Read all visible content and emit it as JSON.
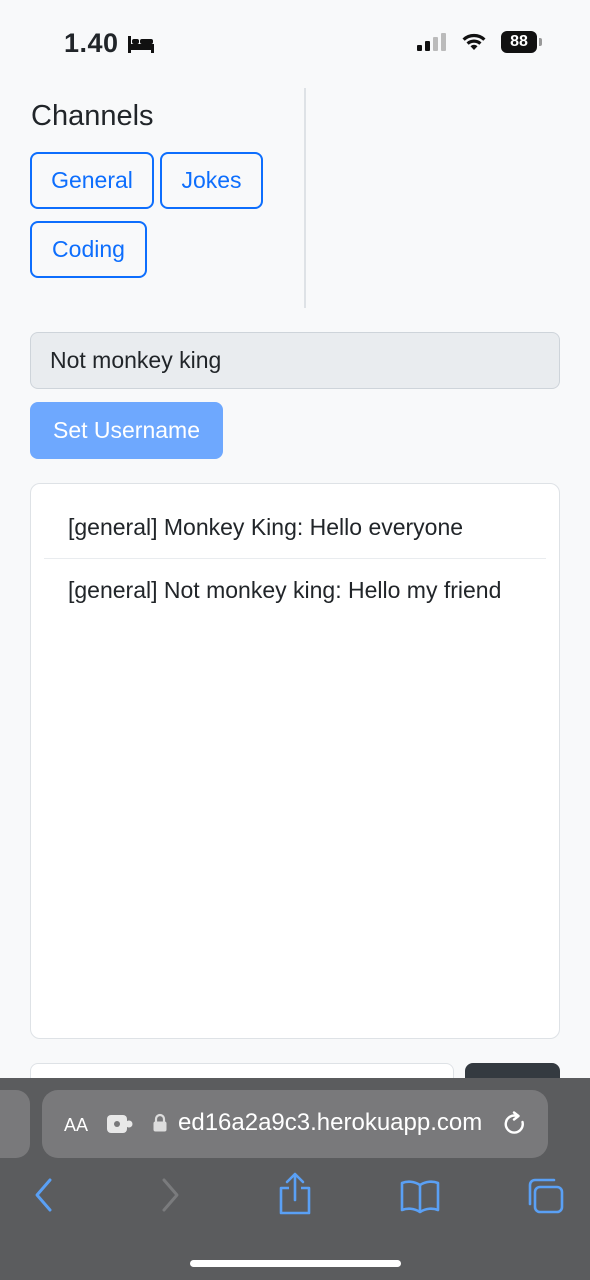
{
  "status_bar": {
    "time": "1.40",
    "sleep_icon": "bed-icon",
    "battery": "88"
  },
  "channels": {
    "title": "Channels",
    "items": [
      {
        "label": "General"
      },
      {
        "label": "Jokes"
      },
      {
        "label": "Coding"
      }
    ]
  },
  "username": {
    "value": "Not monkey king",
    "set_button": "Set Username"
  },
  "messages": [
    {
      "text": "[general] Monkey King: Hello everyone"
    },
    {
      "text": "[general] Not monkey king: Hello my friend"
    }
  ],
  "browser": {
    "text_size_label": "AA",
    "url": "ed16a2a9c3.herokuapp.com",
    "toolbar_icons": [
      "back-icon",
      "forward-icon",
      "share-icon",
      "bookmarks-icon",
      "tabs-icon"
    ]
  },
  "colors": {
    "primary": "#0d6efd",
    "primary_light": "#6ea8fe",
    "safari_bar": "#5b5c5e"
  }
}
